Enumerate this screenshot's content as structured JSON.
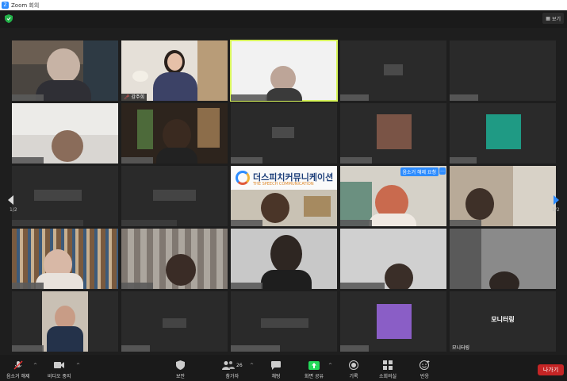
{
  "window": {
    "title": "Zoom 회의"
  },
  "header": {
    "view_label": "보기"
  },
  "pager": {
    "left": "1/2",
    "right": "1/2"
  },
  "tiles": {
    "host_name": "강주희",
    "logo_title": "더스피치커뮤니케이션",
    "logo_subtitle": "THE SPEECH COMMUNICATION",
    "unmute_request": "음소거 해제 요청",
    "more_label": "...",
    "monitor_label": "모니터링",
    "monitor_name": "모니터링"
  },
  "toolbar": {
    "mute": "음소거 해제",
    "video": "비디오 중지",
    "security": "보안",
    "participants": "참가자",
    "participants_count": "26",
    "chat": "채팅",
    "share": "화면 공유",
    "record": "기록",
    "breakout": "소회의실",
    "reactions": "반응",
    "leave": "나가기"
  },
  "colors": {
    "accent": "#2d8cff",
    "leave": "#c52525",
    "active_border": "#d7f55a",
    "share_green": "#23d959"
  }
}
